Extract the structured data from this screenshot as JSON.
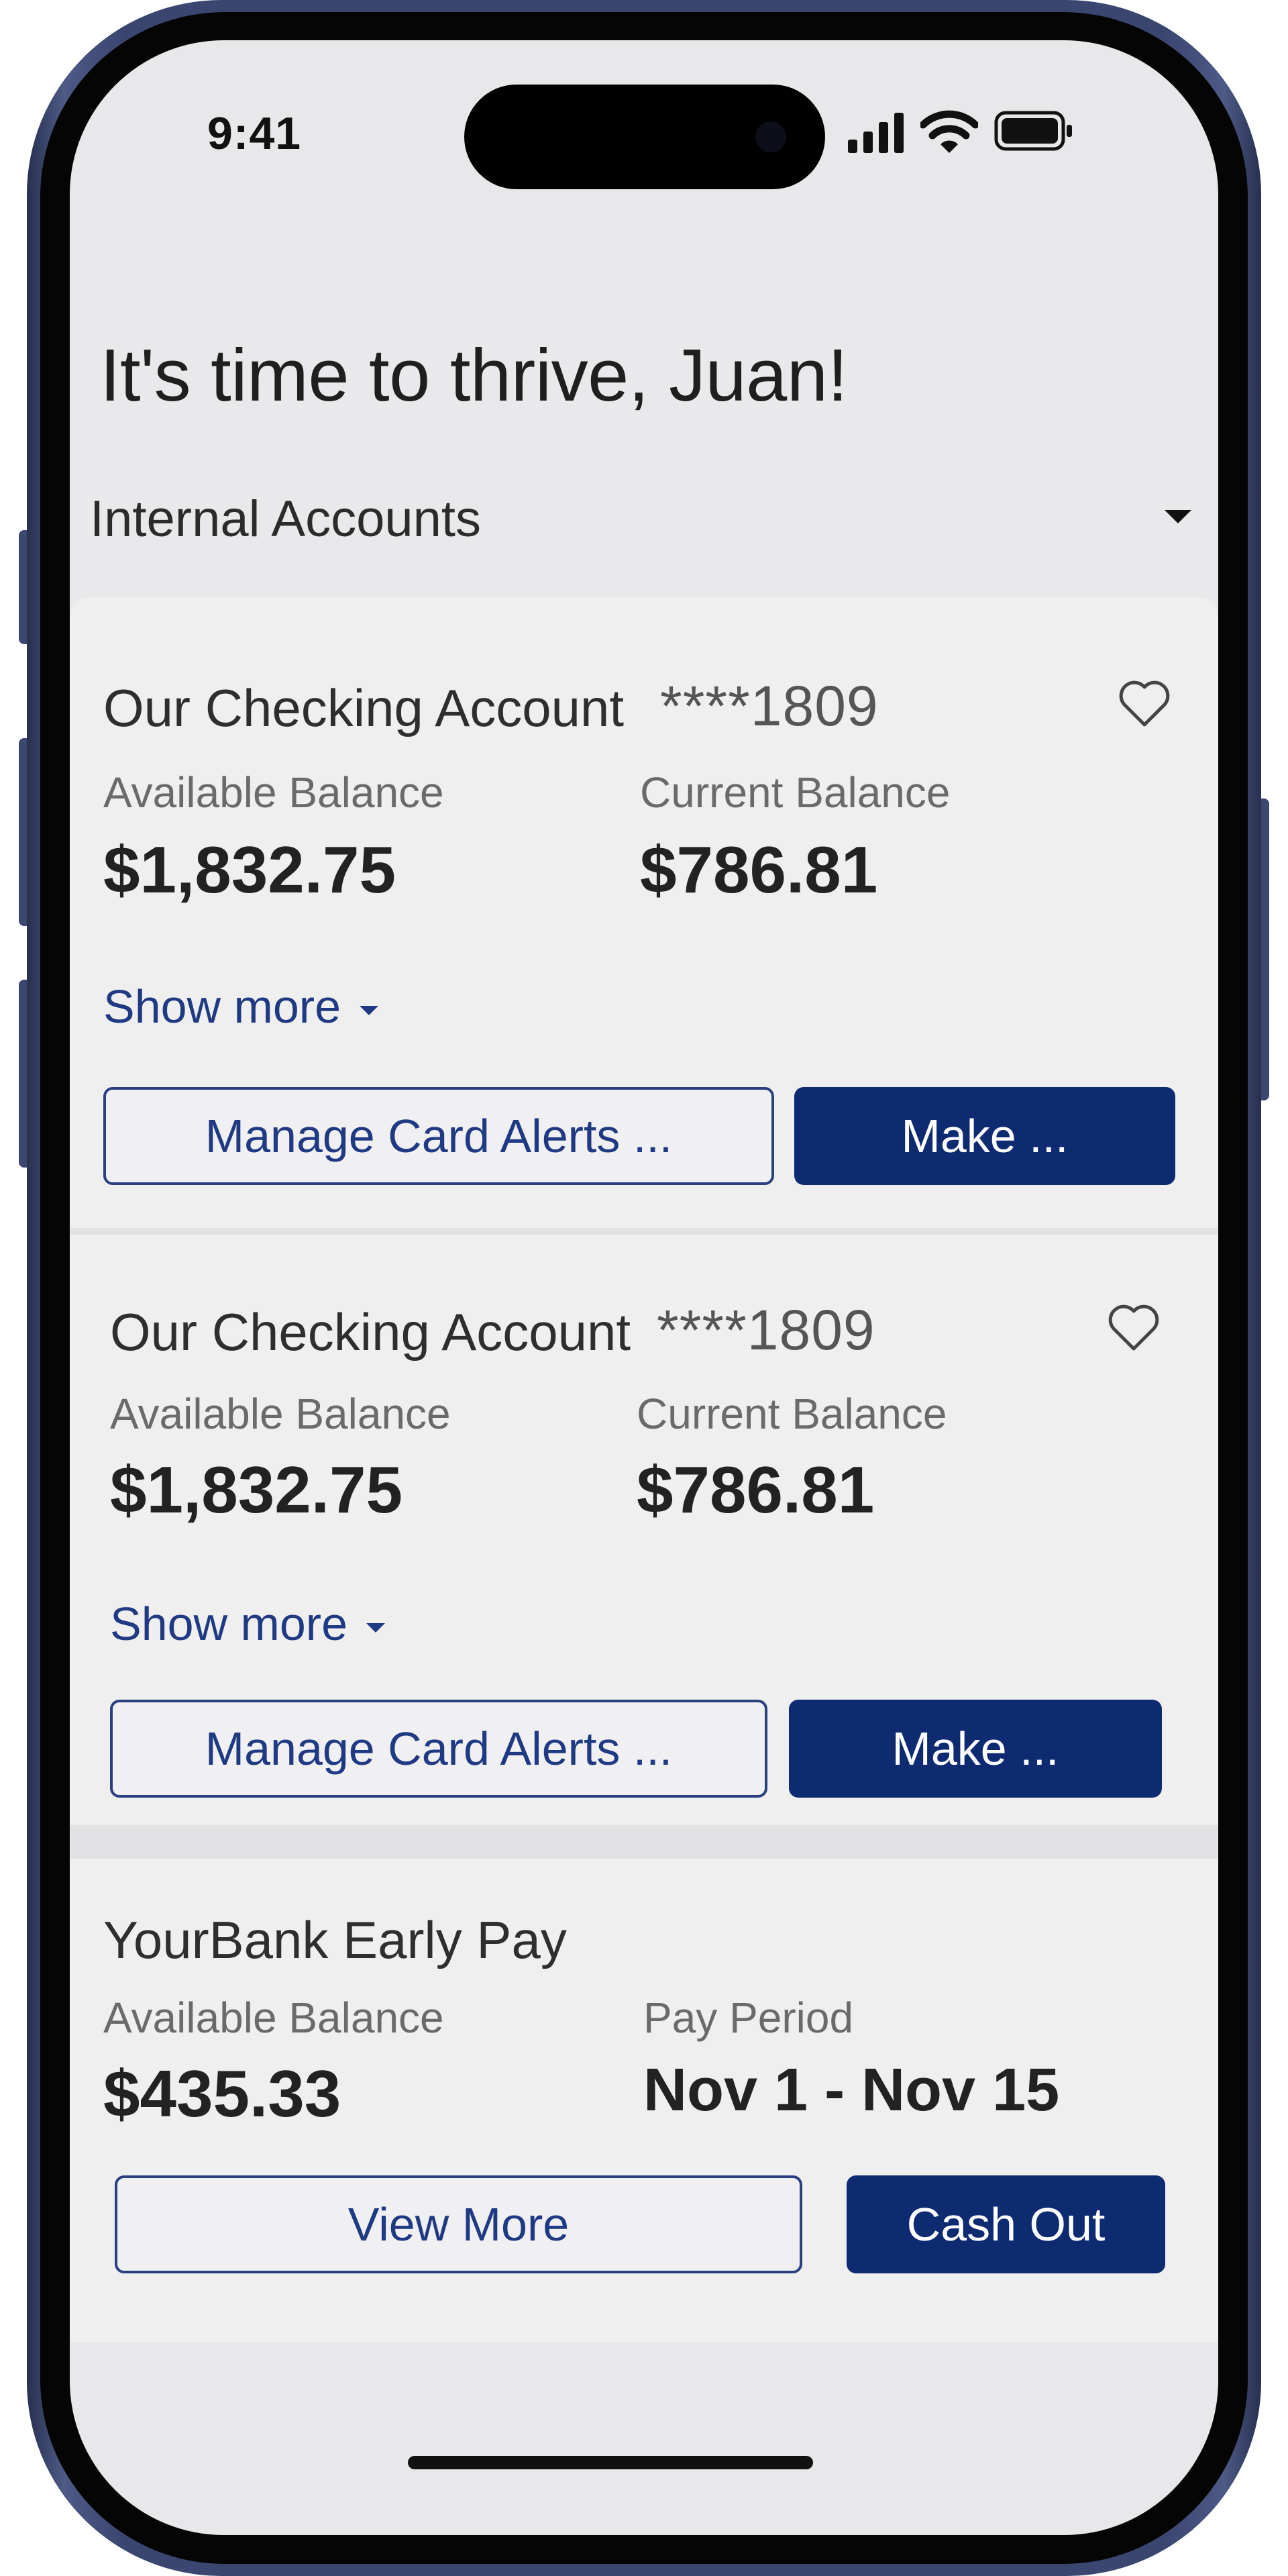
{
  "status_bar": {
    "time": "9:41"
  },
  "greeting": "It's time to thrive, Juan!",
  "account_selector": {
    "label": "Internal Accounts"
  },
  "accounts": [
    {
      "name": "Our Checking Account",
      "number": "****1809",
      "available_label": "Available Balance",
      "available_amount": "$1,832.75",
      "current_label": "Current Balance",
      "current_amount": "$786.81",
      "show_more": "Show more",
      "alerts_button": "Manage Card Alerts ...",
      "make_button": "Make ..."
    },
    {
      "name": "Our Checking Account",
      "number": "****1809",
      "available_label": "Available Balance",
      "available_amount": "$1,832.75",
      "current_label": "Current Balance",
      "current_amount": "$786.81",
      "show_more": "Show more",
      "alerts_button": "Manage Card Alerts ...",
      "make_button": "Make ..."
    }
  ],
  "early_pay": {
    "title": "YourBank Early Pay",
    "available_label": "Available Balance",
    "available_amount": "$435.33",
    "period_label": "Pay Period",
    "period_value": "Nov 1 - Nov 15",
    "view_more_button": "View More",
    "cash_out_button": "Cash Out"
  },
  "colors": {
    "primary": "#0e2a70",
    "link": "#1f3a82",
    "card_background": "#efefef",
    "screen_background": "#e8e8ea"
  }
}
